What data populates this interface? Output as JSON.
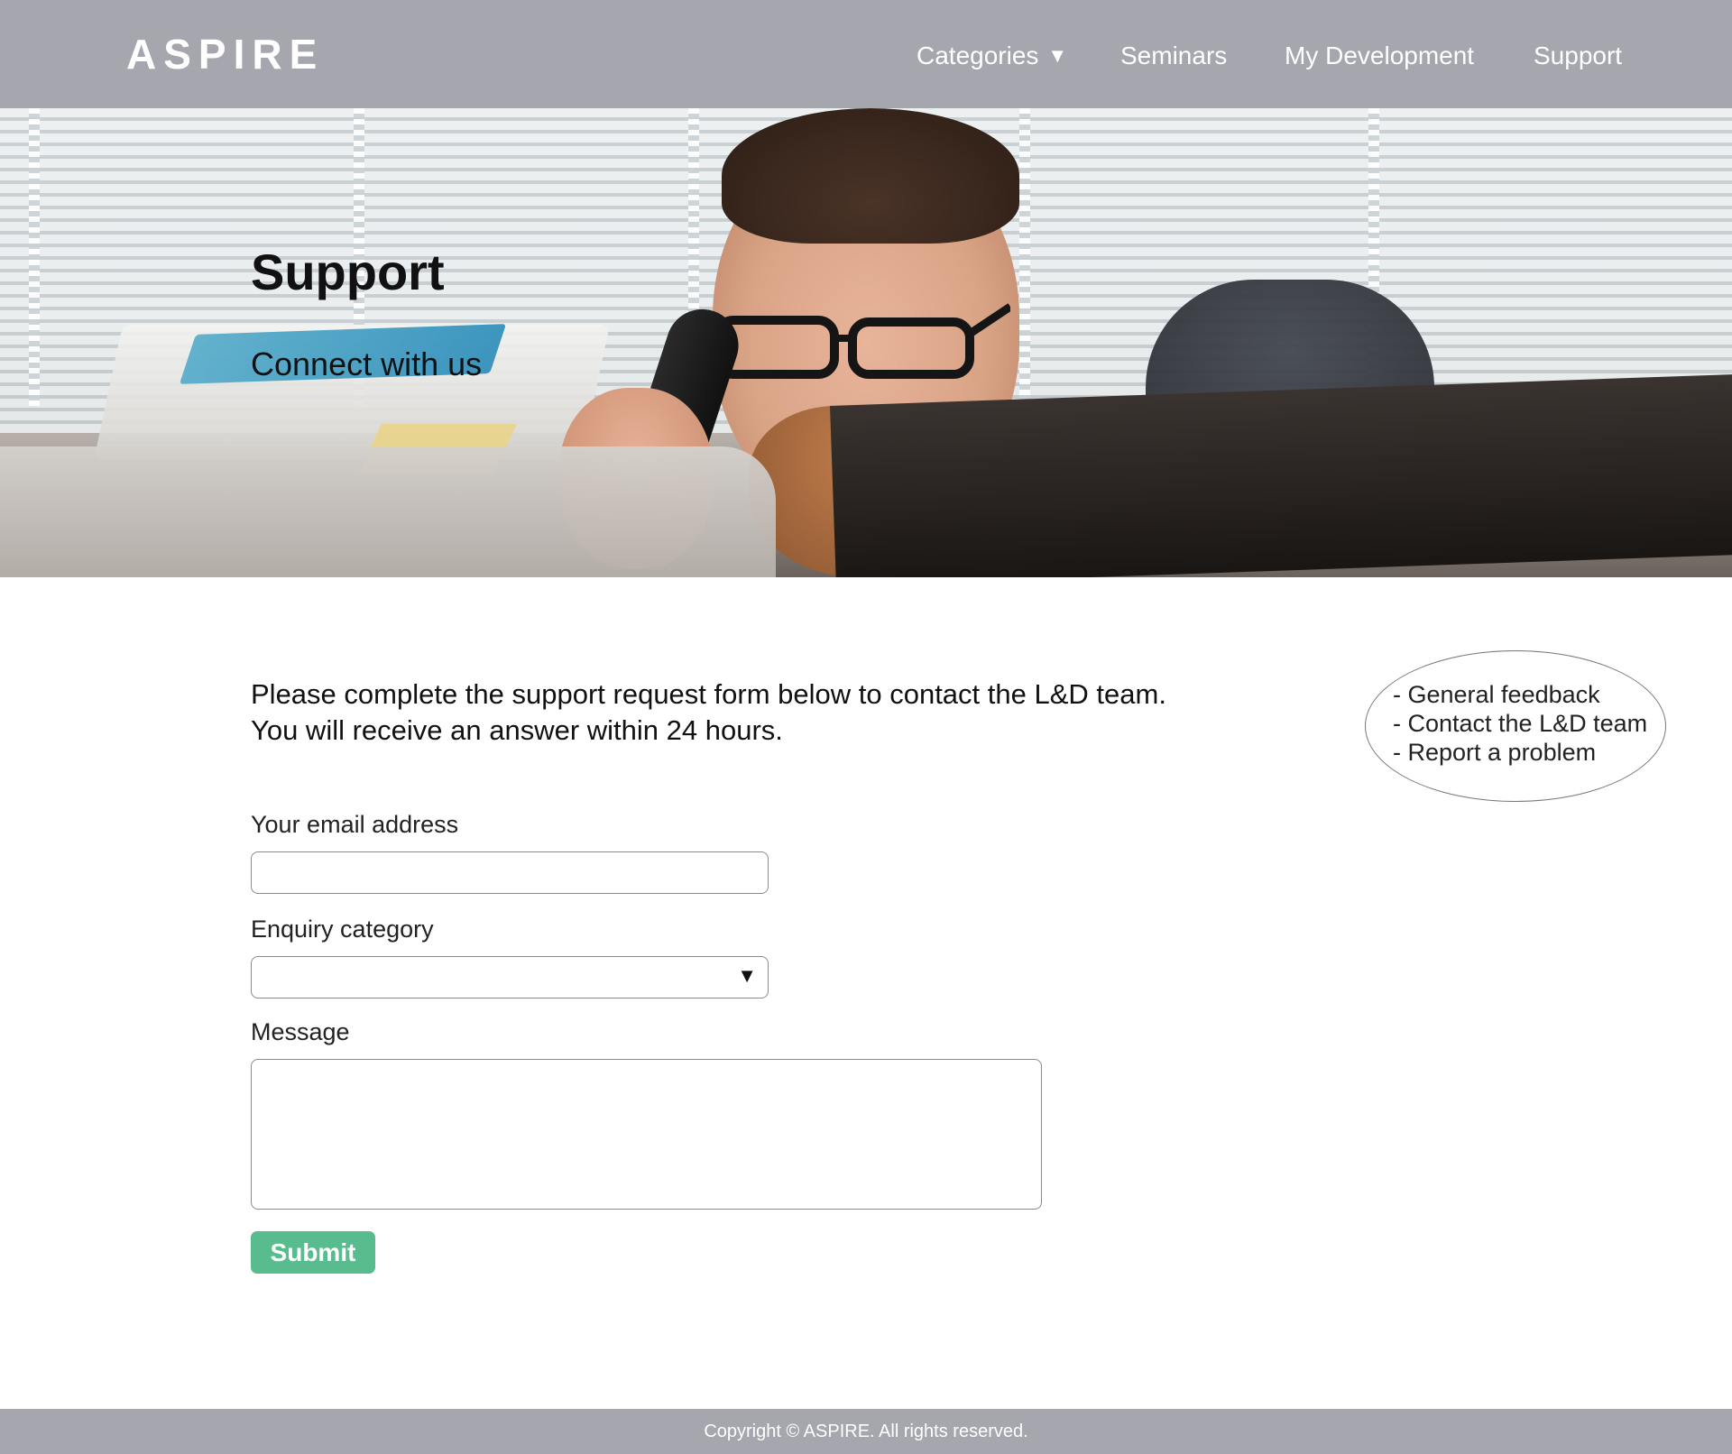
{
  "brand": {
    "logo": "ASPIRE"
  },
  "nav": {
    "items": [
      {
        "label": "Categories",
        "caret": "▼"
      },
      {
        "label": "Seminars"
      },
      {
        "label": "My Development"
      },
      {
        "label": "Support"
      }
    ]
  },
  "hero": {
    "title": "Support",
    "subtitle": "Connect with us"
  },
  "intro": {
    "line1": "Please complete the support request form below to contact the L&D team.",
    "line2": "You will receive an answer within 24 hours."
  },
  "side_options": [
    "- General feedback",
    "- Contact the L&D team",
    "- Report a problem"
  ],
  "form": {
    "email_label": "Your email address",
    "email_value": "",
    "category_label": "Enquiry category",
    "category_value": "",
    "category_caret": "▼",
    "message_label": "Message",
    "message_value": "",
    "submit_label": "Submit"
  },
  "footer": {
    "copyright": "Copyright © ASPIRE. All rights reserved."
  },
  "colors": {
    "header_bg": "#a5a6ae",
    "submit_bg": "#58bc8e",
    "text": "#111111"
  }
}
